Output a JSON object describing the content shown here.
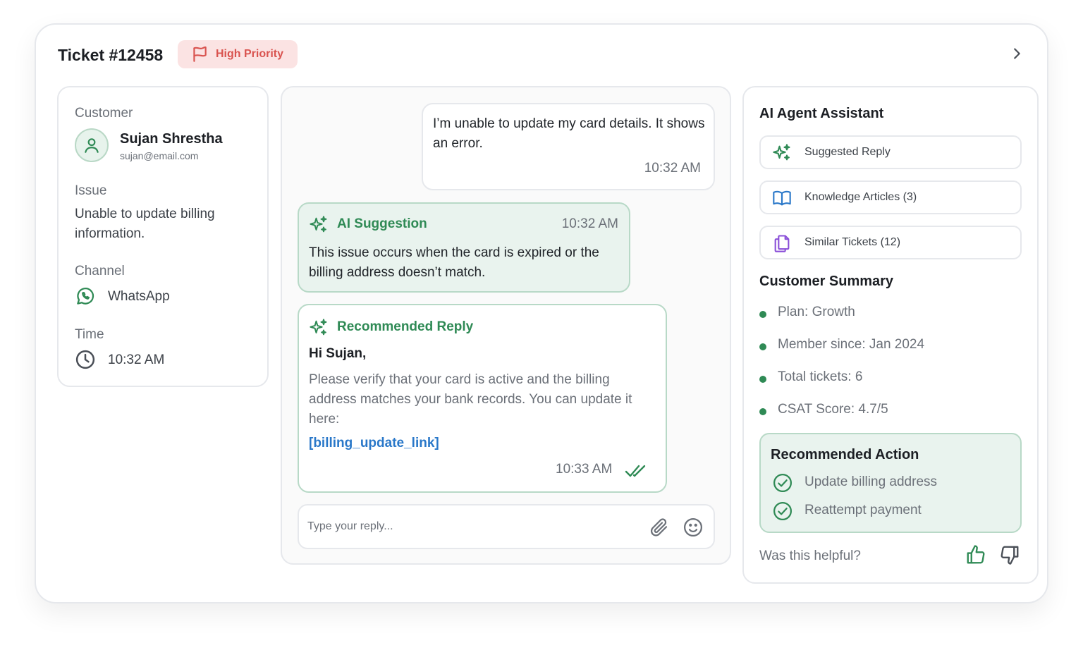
{
  "header": {
    "title": "Ticket #12458",
    "priority": "High Priority",
    "priority_color": "#d9534f",
    "expand_icon": "chevron-right-icon"
  },
  "customer_panel": {
    "customer_label": "Customer",
    "name": "Sujan Shrestha",
    "email": "sujan@email.com",
    "issue_label": "Issue",
    "issue_text": "Unable to update billing information.",
    "channel_label": "Channel",
    "channel_value": "WhatsApp",
    "time_label": "Time",
    "time_value": "10:32 AM"
  },
  "conversation": {
    "user_message": {
      "text": "I’m unable to update my card details. It shows an error.",
      "time": "10:32 AM"
    },
    "ai_suggestion": {
      "title": "AI Suggestion",
      "time": "10:32 AM",
      "text": "This issue occurs when the card is expired or the billing address doesn’t match."
    },
    "recommended_reply": {
      "title": "Recommended Reply",
      "greeting": "Hi Sujan,",
      "body": "Please verify that your card is active and the billing address matches your bank records. You can update it here:",
      "link": "[billing_update_link]",
      "time": "10:33 AM",
      "status_icon": "double-check-icon"
    },
    "reply_placeholder": "Type your reply..."
  },
  "assistant": {
    "title": "AI Agent Assistant",
    "tools": [
      {
        "label": "Suggested Reply",
        "icon": "sparkles-icon"
      },
      {
        "label": "Knowledge Articles (3)",
        "icon": "book-icon"
      },
      {
        "label": "Similar Tickets (12)",
        "icon": "documents-icon"
      }
    ],
    "summary_title": "Customer Summary",
    "summary_items": [
      "Plan: Growth",
      "Member since: Jan 2024",
      "Total tickets: 6",
      "CSAT Score: 4.7/5"
    ],
    "recommended_action": {
      "title": "Recommended Action",
      "items": [
        "Update billing address",
        "Reattempt payment"
      ]
    },
    "feedback_prompt": "Was this helpful?"
  },
  "colors": {
    "accent_green": "#2f8a55",
    "link_blue": "#2a78c9",
    "priority_bg": "#fbe3e3",
    "suggestion_bg": "#e9f3ee",
    "knowledge_icon": "#2a78c9",
    "tickets_icon": "#8a4fd8"
  }
}
